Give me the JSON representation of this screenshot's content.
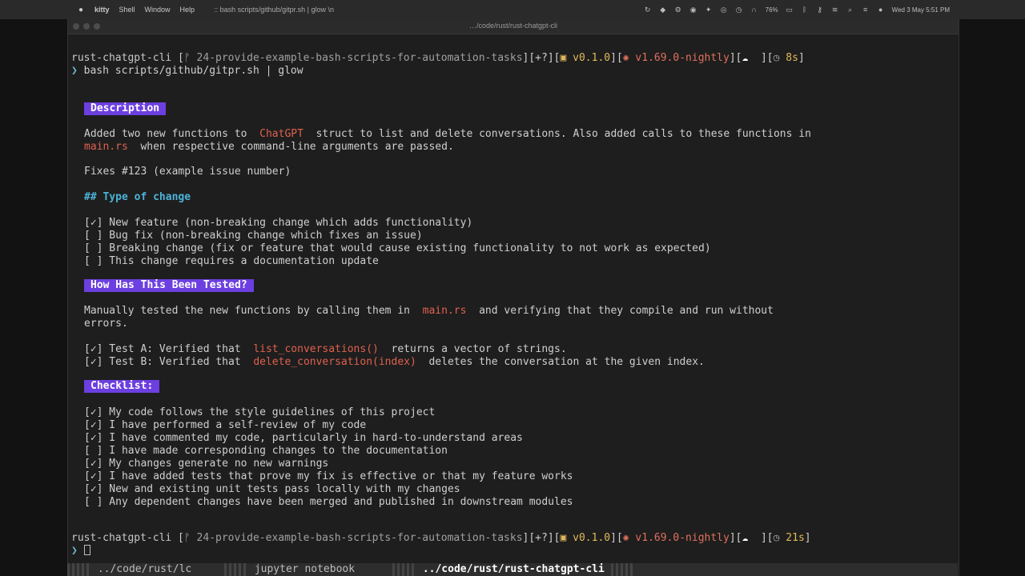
{
  "menubar": {
    "app": "kitty",
    "items": [
      "Shell",
      "Window",
      "Help"
    ],
    "window_title": ":: bash scripts/github/gitpr.sh | glow \\n",
    "battery": "76%",
    "datetime": "Wed 3 May  5:51 PM"
  },
  "window": {
    "title": "…/code/rust/rust-chatgpt-cli"
  },
  "prompt1": {
    "dir": "rust-chatgpt-cli",
    "open": " [",
    "branch": " 24-provide-example-bash-scripts-for-automation-tasks",
    "status": "][+?][",
    "pkg_version": " v0.1.0",
    "sep": "][",
    "rust_version": " v1.69.0-nightly",
    "sep2": "][",
    "cloud": "☁",
    "sep3": "  ][",
    "duration": " 8s",
    "close": "]"
  },
  "command": {
    "symbol": "❯",
    "text": " bash scripts/github/gitpr.sh | glow"
  },
  "doc": {
    "description_heading": "Description",
    "desc_line1_a": "Added two new functions to ",
    "desc_line1_code": " ChatGPT ",
    "desc_line1_b": " struct to list and delete conversations. Also added calls to these functions in",
    "desc_line2_code": "main.rs",
    "desc_line2_b": "  when respective command-line arguments are passed.",
    "fixes": "Fixes #123 (example issue number)",
    "type_heading": "## Type of change",
    "type_items": [
      "[✓] New feature (non-breaking change which adds functionality)",
      "[ ] Bug fix (non-breaking change which fixes an issue)",
      "[ ] Breaking change (fix or feature that would cause existing functionality to not work as expected)",
      "[ ] This change requires a documentation update"
    ],
    "tested_heading": "How Has This Been Tested?",
    "tested_line1_a": "Manually tested the new functions by calling them in ",
    "tested_line1_code": " main.rs ",
    "tested_line1_b": " and verifying that they compile and run without",
    "tested_line2": "errors.",
    "testA_a": "[✓] Test A: Verified that ",
    "testA_code": " list_conversations() ",
    "testA_b": " returns a vector of strings.",
    "testB_a": "[✓] Test B: Verified that ",
    "testB_code": " delete_conversation(index) ",
    "testB_b": " deletes the conversation at the given index.",
    "checklist_heading": "Checklist:",
    "checklist_items": [
      "[✓] My code follows the style guidelines of this project",
      "[✓] I have performed a self-review of my code",
      "[✓] I have commented my code, particularly in hard-to-understand areas",
      "[ ] I have made corresponding changes to the documentation",
      "[✓] My changes generate no new warnings",
      "[✓] I have added tests that prove my fix is effective or that my feature works",
      "[✓] New and existing unit tests pass locally with my changes",
      "[ ] Any dependent changes have been merged and published in downstream modules"
    ]
  },
  "prompt2": {
    "dir": "rust-chatgpt-cli",
    "open": " [",
    "branch": " 24-provide-example-bash-scripts-for-automation-tasks",
    "status": "][+?][",
    "pkg_version": " v0.1.0",
    "sep": "][",
    "rust_version": " v1.69.0-nightly",
    "sep2": "][",
    "cloud": "☁",
    "sep3": "  ][",
    "duration": " 21s",
    "close": "]"
  },
  "prompt_symbol": "❯",
  "tabs": [
    {
      "label": " ../code/rust/lc "
    },
    {
      "label": " jupyter notebook "
    },
    {
      "label": " ../code/rust/rust-chatgpt-cli "
    }
  ]
}
